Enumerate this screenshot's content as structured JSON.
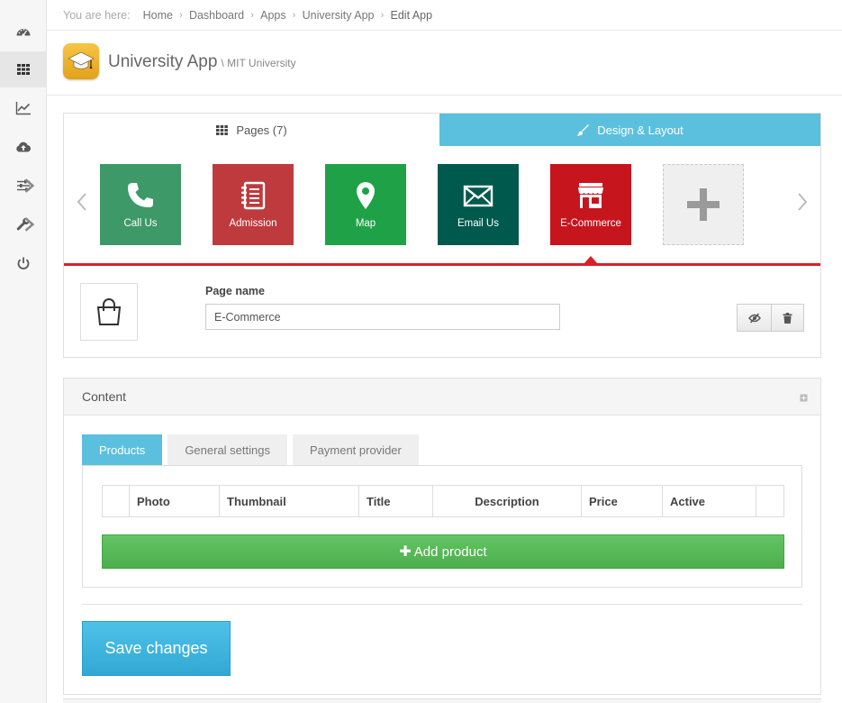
{
  "breadcrumb": {
    "lead": "You are here:",
    "items": [
      "Home",
      "Dashboard",
      "Apps",
      "University App",
      "Edit App"
    ]
  },
  "app": {
    "title": "University App",
    "subtitle": "\\ MIT University",
    "icon": "graduation-cap-icon"
  },
  "sidebar": {
    "items": [
      {
        "icon": "dashboard-gauge-icon"
      },
      {
        "icon": "grid-apps-icon",
        "active": true
      },
      {
        "icon": "line-chart-icon"
      },
      {
        "icon": "cloud-upload-icon"
      },
      {
        "icon": "sliders-icon",
        "has_submenu": true
      },
      {
        "icon": "wrench-icon",
        "has_submenu": true
      },
      {
        "icon": "power-icon"
      }
    ]
  },
  "tabs": {
    "pages_label": "Pages (7)",
    "design_label": "Design & Layout"
  },
  "pages": [
    {
      "label": "Call Us",
      "color": "#3d9967",
      "icon": "phone-icon"
    },
    {
      "label": "Admission",
      "color": "#bf3a3d",
      "icon": "notebook-icon"
    },
    {
      "label": "Map",
      "color": "#1fa247",
      "icon": "map-marker-icon"
    },
    {
      "label": "Email Us",
      "color": "#00594d",
      "icon": "envelope-icon"
    },
    {
      "label": "E-Commerce",
      "color": "#c7151e",
      "icon": "store-icon",
      "selected": true
    }
  ],
  "page_editor": {
    "label": "Page name",
    "value": "E-Commerce",
    "icon": "shopping-bag-icon"
  },
  "content": {
    "title": "Content",
    "tabs": [
      "Products",
      "General settings",
      "Payment provider"
    ],
    "active_tab": "Products",
    "columns": [
      "",
      "Photo",
      "Thumbnail",
      "Title",
      "Description",
      "Price",
      "Active",
      ""
    ],
    "add_button": "Add product"
  },
  "save_button": "Save changes",
  "colors": {
    "accent_blue": "#5bc0de",
    "accent_red": "#d9202a",
    "success_green": "#5cb85c"
  }
}
